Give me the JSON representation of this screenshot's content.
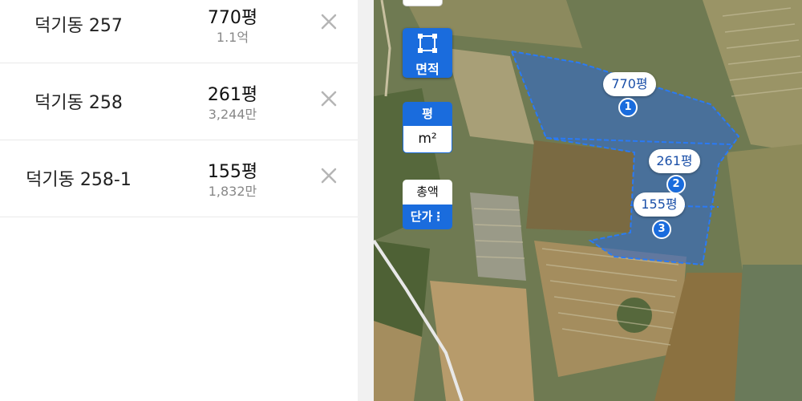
{
  "parcels": [
    {
      "name": "덕기동 257",
      "area": "770평",
      "price": "1.1억"
    },
    {
      "name": "덕기동 258",
      "area": "261평",
      "price": "3,244만"
    },
    {
      "name": "덕기동 258-1",
      "area": "155평",
      "price": "1,832만"
    }
  ],
  "map": {
    "area_button_label": "면적",
    "unit_pyeong": "평",
    "unit_m2": "m²",
    "total_label": "총액",
    "unit_price_label": "단가⋮",
    "labels": [
      {
        "area": "770평",
        "num": "1"
      },
      {
        "area": "261평",
        "num": "2"
      },
      {
        "area": "155평",
        "num": "3"
      }
    ],
    "accent_color": "#1a6cdd"
  }
}
